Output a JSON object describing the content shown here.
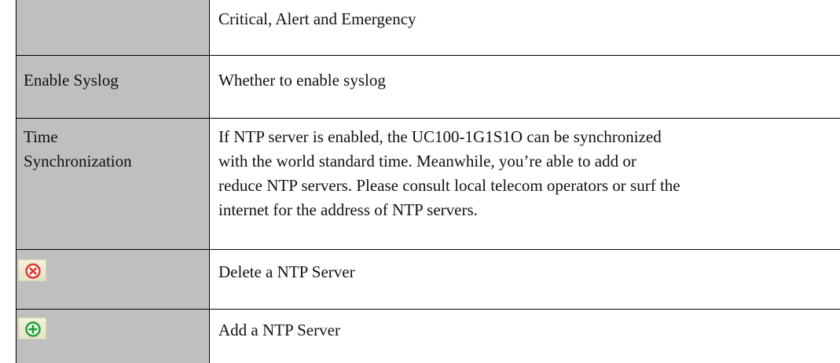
{
  "table": {
    "rows": [
      {
        "term": "",
        "description": "Critical, Alert and Emergency"
      },
      {
        "term": "Enable Syslog",
        "description": "Whether to enable syslog"
      },
      {
        "term_lines": [
          "Time",
          "Synchronization"
        ],
        "description_lines": [
          "If NTP server is enabled, the UC100-1G1S1O can be synchronized",
          "with the world standard time. Meanwhile, you’re able to add or",
          "reduce NTP servers. Please consult local telecom operators or surf the",
          "internet for the address of NTP servers."
        ]
      },
      {
        "icon": "delete-circle-icon",
        "icon_color": "#e0302a",
        "description": "Delete a NTP Server"
      },
      {
        "icon": "add-circle-icon",
        "icon_color": "#1a9e2f",
        "description": "Add a NTP Server"
      }
    ]
  },
  "colors": {
    "label_column_bg": "#bfbfbf",
    "border": "#000000"
  }
}
